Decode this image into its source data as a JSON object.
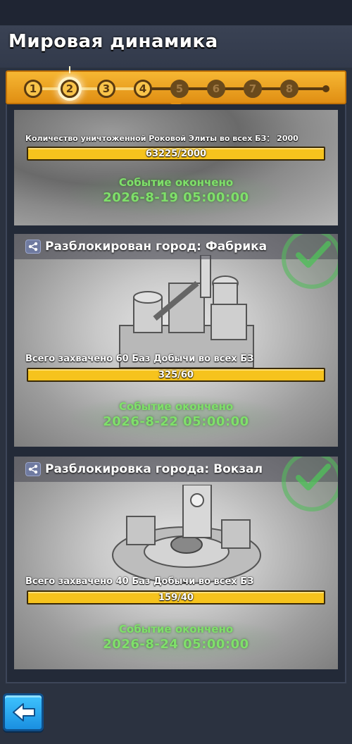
{
  "header": {
    "title": "Мировая динамика"
  },
  "steps": [
    "1",
    "2",
    "3",
    "4",
    "5",
    "6",
    "7",
    "8"
  ],
  "active_step": "2",
  "cards": [
    {
      "title": "",
      "task": "Количество уничтоженной Роковой Элиты во всех БЗ： 2000",
      "progress_text": "63225/2000",
      "status": "Событие окончено",
      "date": "2026-8-19 05:00:00"
    },
    {
      "title": "Разблокирован город: Фабрика",
      "task": "Всего захвачено 60 Баз Добычи во всех БЗ",
      "progress_text": "325/60",
      "status": "Событие окончено",
      "date": "2026-8-22 05:00:00"
    },
    {
      "title": "Разблокировка города: Вокзал",
      "task": "Всего захвачено 40 Баз Добычи во всех БЗ",
      "progress_text": "159/40",
      "status": "Событие окончено",
      "date": "2026-8-24 05:00:00"
    }
  ],
  "colors": {
    "progress_fill": "#f6c31d",
    "status_green": "#7fe06a",
    "step_orange": "#f0a123",
    "back_blue": "#2aa8f0"
  },
  "icons": {
    "share": "share-icon",
    "check": "check-icon",
    "back": "back-arrow-icon"
  }
}
